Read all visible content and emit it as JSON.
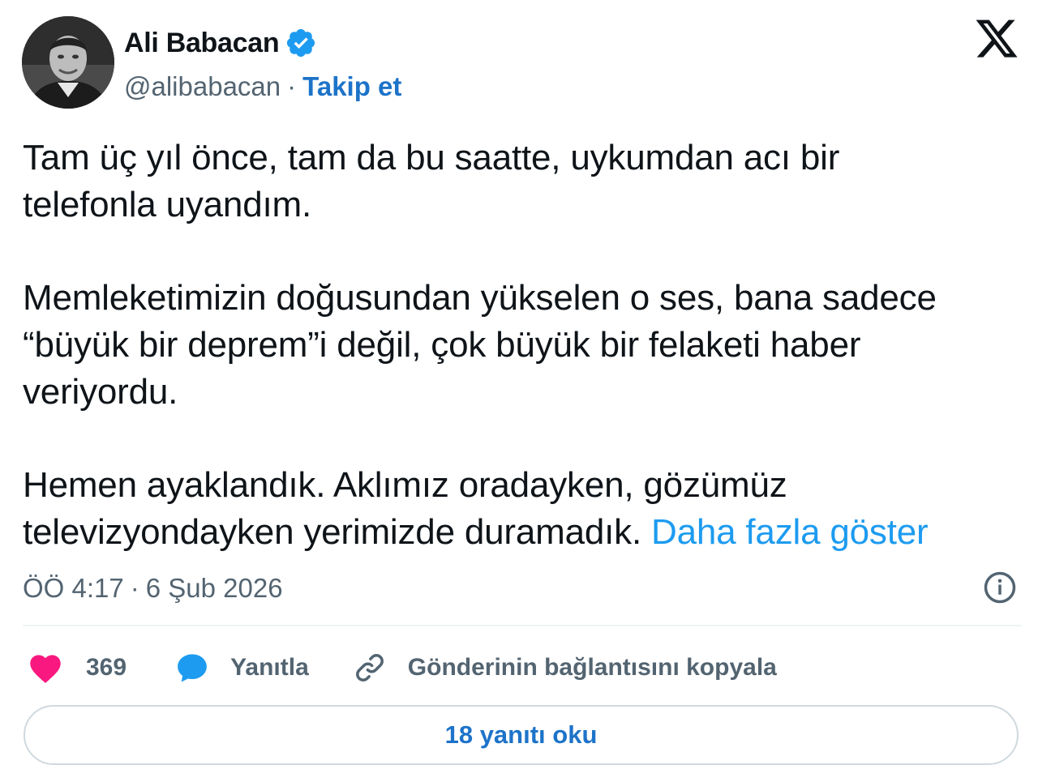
{
  "author": {
    "name": "Ali Babacan",
    "handle": "@alibabacan",
    "separator": "·",
    "follow_label": "Takip et"
  },
  "icons": {
    "verified": "verified-badge-icon",
    "platform": "x-logo-icon",
    "info": "info-icon",
    "like": "heart-icon",
    "reply": "speech-bubble-icon",
    "copy": "link-icon"
  },
  "tweet": {
    "paragraph_1": "Tam üç yıl önce, tam da bu saatte, uykumdan acı bir\ntelefonla uyandım.",
    "paragraph_2": "Memleketimizin doğusundan yükselen o ses, bana sadece\n“büyük bir deprem”i değil, çok büyük bir felaketi haber\nveriyordu.",
    "paragraph_3": "Hemen ayaklandık. Aklımız oradayken, gözümüz\ntelevizyondayken yerimizde duramadık. ",
    "show_more": "Daha fazla göster"
  },
  "meta": {
    "time": "ÖÖ 4:17",
    "separator": "·",
    "date": "6 Şub 2026"
  },
  "actions": {
    "like_count": "369",
    "reply_label": "Yanıtla",
    "copy_label": "Gönderinin bağlantısını kopyala"
  },
  "read_replies_label": "18 yanıtı oku",
  "colors": {
    "accent": "#1d9bf0",
    "follow": "#1d73c9",
    "like": "#f91880",
    "secondary_text": "#536471",
    "border": "#cfd9de"
  }
}
